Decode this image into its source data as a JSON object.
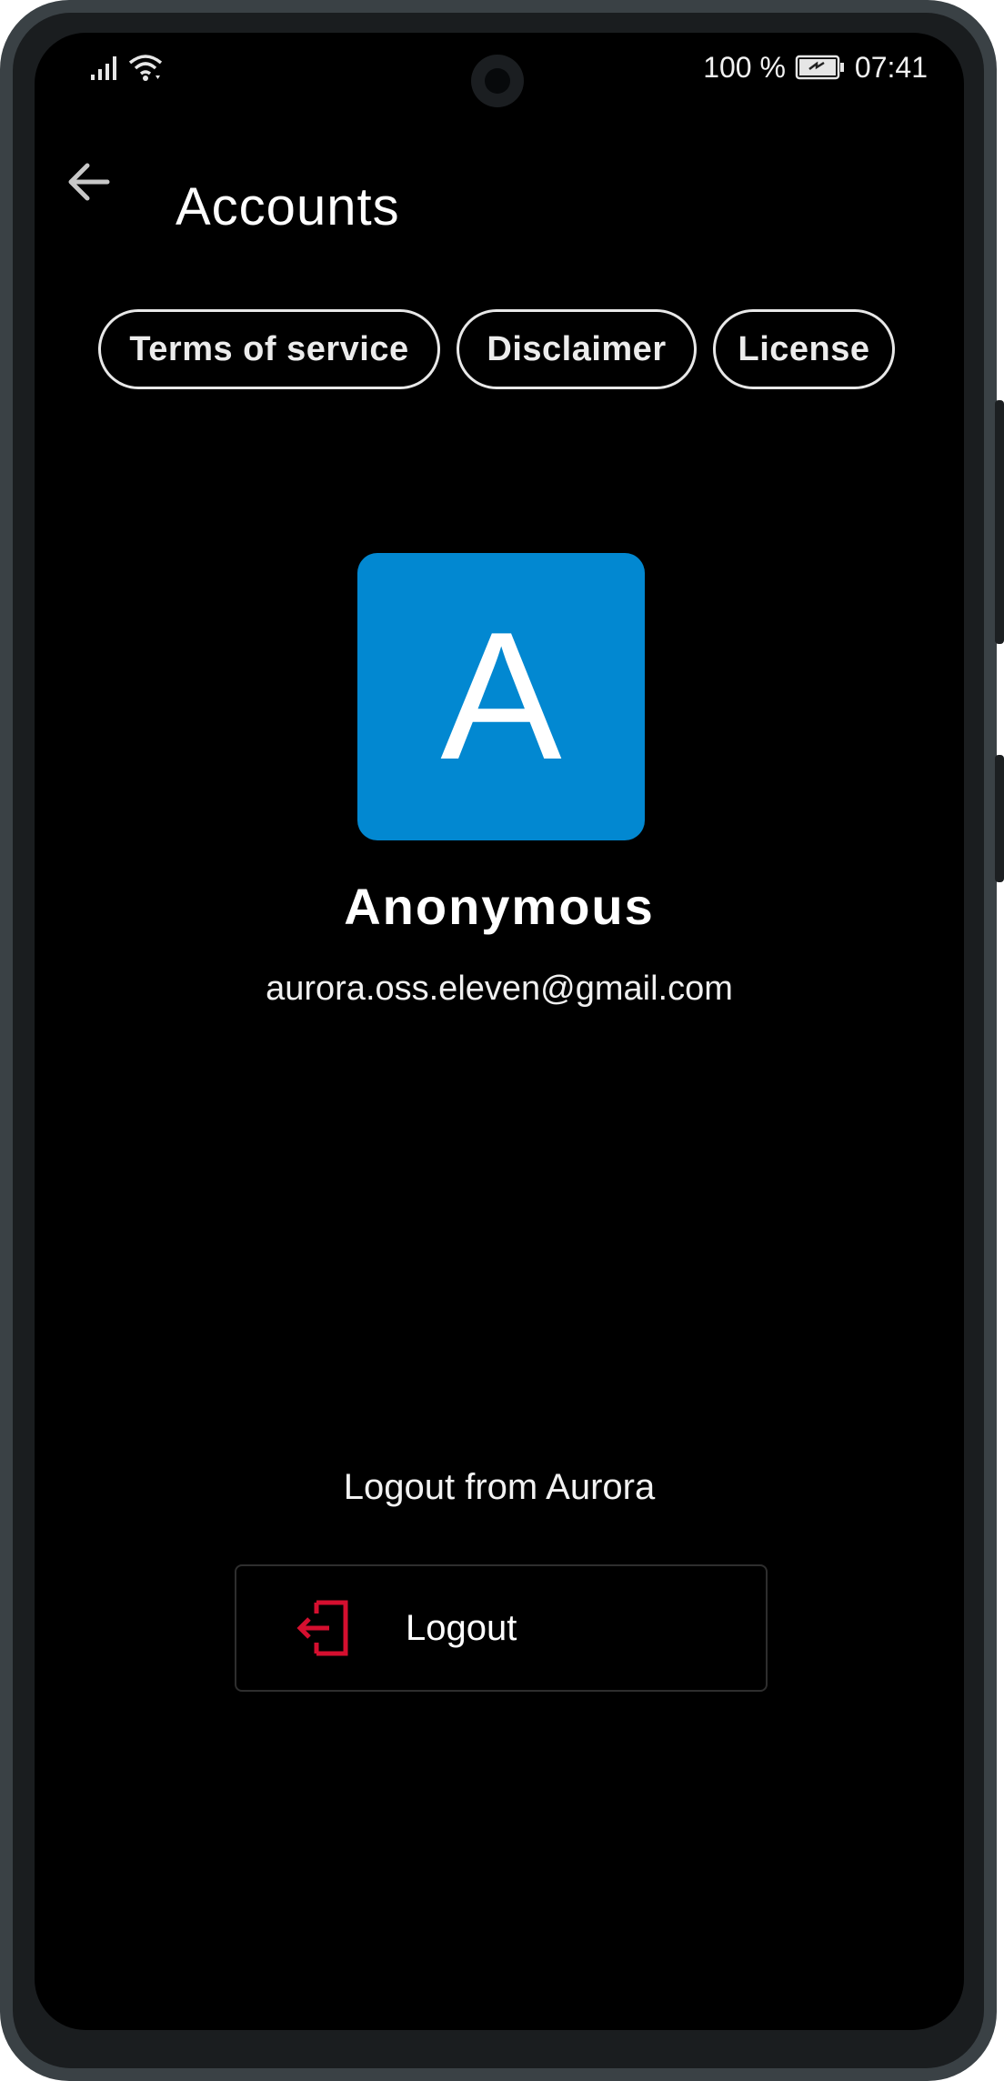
{
  "status_bar": {
    "battery_text": "100 %",
    "time": "07:41"
  },
  "app_bar": {
    "title": "Accounts"
  },
  "chips": {
    "terms": "Terms of service",
    "disclaimer": "Disclaimer",
    "license": "License"
  },
  "profile": {
    "avatar_letter": "A",
    "avatar_color": "#0288D1",
    "name": "Anonymous",
    "email": "aurora.oss.eleven@gmail.com"
  },
  "logout": {
    "section_label": "Logout from Aurora",
    "button_label": "Logout",
    "icon_color": "#D50F2F"
  },
  "icons": [
    "signal-icon",
    "wifi-icon",
    "battery-icon",
    "back-arrow-icon",
    "logout-icon"
  ]
}
